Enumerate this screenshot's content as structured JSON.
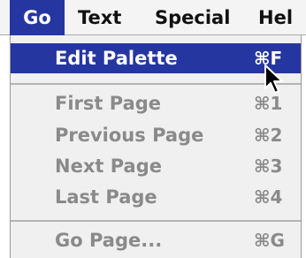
{
  "menubar": {
    "items": [
      {
        "label": "Go",
        "active": true
      },
      {
        "label": "Text",
        "active": false
      },
      {
        "label": "Special",
        "active": false
      },
      {
        "label": "Hel",
        "active": false
      }
    ]
  },
  "menu": {
    "items": [
      {
        "label": "Edit Palette",
        "shortcut": "⌘F",
        "state": "highlighted"
      },
      {
        "label": "First Page",
        "shortcut": "⌘1",
        "state": "disabled"
      },
      {
        "label": "Previous Page",
        "shortcut": "⌘2",
        "state": "disabled"
      },
      {
        "label": "Next Page",
        "shortcut": "⌘3",
        "state": "disabled"
      },
      {
        "label": "Last Page",
        "shortcut": "⌘4",
        "state": "disabled"
      },
      {
        "label": "Go Page...",
        "shortcut": "⌘G",
        "state": "disabled"
      }
    ]
  },
  "colors": {
    "highlight": "#2636a0",
    "disabled_text": "#8a8a8a",
    "menu_background": "#f0f0f0"
  },
  "icons": {
    "pointer": "arrow-cursor-icon"
  }
}
